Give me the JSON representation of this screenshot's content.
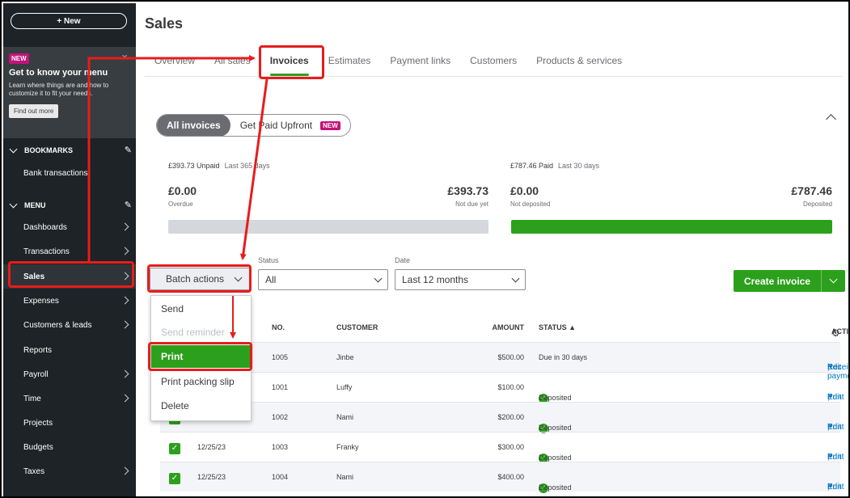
{
  "sidebar": {
    "new_label": "+ New",
    "promo": {
      "badge": "NEW",
      "title": "Get to know your menu",
      "text": "Learn where things are and how to customize it to fit your needs.",
      "button": "Find out more",
      "close": "×"
    },
    "bookmarks_label": "BOOKMARKS",
    "bookmark_item": "Bank transactions",
    "menu_label": "MENU",
    "items": [
      {
        "label": "Dashboards",
        "has_arrow": true
      },
      {
        "label": "Transactions",
        "has_arrow": true
      },
      {
        "label": "Sales",
        "has_arrow": true,
        "active": true
      },
      {
        "label": "Expenses",
        "has_arrow": true
      },
      {
        "label": "Customers & leads",
        "has_arrow": true
      },
      {
        "label": "Reports",
        "has_arrow": false
      },
      {
        "label": "Payroll",
        "has_arrow": true
      },
      {
        "label": "Time",
        "has_arrow": true
      },
      {
        "label": "Projects",
        "has_arrow": false
      },
      {
        "label": "Budgets",
        "has_arrow": false
      },
      {
        "label": "Taxes",
        "has_arrow": true
      }
    ]
  },
  "page": {
    "title": "Sales",
    "tabs": [
      "Overview",
      "All sales",
      "Invoices",
      "Estimates",
      "Payment links",
      "Customers",
      "Products & services"
    ],
    "active_tab": "Invoices"
  },
  "toggle": {
    "all_invoices": "All invoices",
    "get_paid": "Get Paid Upfront",
    "new_badge": "NEW"
  },
  "summary": {
    "unpaid_amount": "£393.73 Unpaid",
    "unpaid_period": "Last 365 days",
    "overdue_value": "£0.00",
    "overdue_label": "Overdue",
    "not_due_value": "£393.73",
    "not_due_label": "Not due yet",
    "paid_amount": "£787.46 Paid",
    "paid_period": "Last 30 days",
    "not_deposited_value": "£0.00",
    "not_deposited_label": "Not deposited",
    "deposited_value": "£787.46",
    "deposited_label": "Deposited",
    "unpaid_bar_color": "#d4d7dc",
    "paid_bar_color": "#2ca01c"
  },
  "filters": {
    "batch_label": "Batch actions",
    "status_label": "Status",
    "status_value": "All",
    "date_label": "Date",
    "date_value": "Last 12 months",
    "create_label": "Create invoice"
  },
  "batch_menu": {
    "items": [
      "Send",
      "Send reminder",
      "Print",
      "Print packing slip",
      "Delete"
    ],
    "disabled": [
      "Send reminder"
    ],
    "highlighted": "Print"
  },
  "table": {
    "headers": {
      "no": "NO.",
      "customer": "CUSTOMER",
      "amount": "AMOUNT",
      "status": "STATUS ▲",
      "action": "ACTION"
    },
    "rows": [
      {
        "date": "",
        "no": "1005",
        "customer": "Jinbe",
        "amount": "$500.00",
        "status": "Due in 30 days",
        "deposited": false,
        "actions": [
          "Edit",
          "Receive payment"
        ]
      },
      {
        "date": "",
        "no": "1001",
        "customer": "Luffy",
        "amount": "$100.00",
        "status": "Deposited",
        "deposited": true,
        "actions": [
          "Edit",
          "Print"
        ]
      },
      {
        "date": "",
        "no": "1002",
        "customer": "Nami",
        "amount": "$200.00",
        "status": "Deposited",
        "deposited": true,
        "actions": [
          "Edit",
          "Print"
        ]
      },
      {
        "date": "12/25/23",
        "no": "1003",
        "customer": "Franky",
        "amount": "$300.00",
        "status": "Deposited",
        "deposited": true,
        "actions": [
          "Edit",
          "Print"
        ]
      },
      {
        "date": "12/25/23",
        "no": "1004",
        "customer": "Nami",
        "amount": "$400.00",
        "status": "Deposited",
        "deposited": true,
        "actions": [
          "Edit",
          "Print"
        ]
      }
    ]
  },
  "colors": {
    "accent_green": "#2ca01c",
    "annotation_red": "#e81c1c",
    "sidebar_bg": "#1d2326",
    "link_blue": "#0077c5"
  }
}
